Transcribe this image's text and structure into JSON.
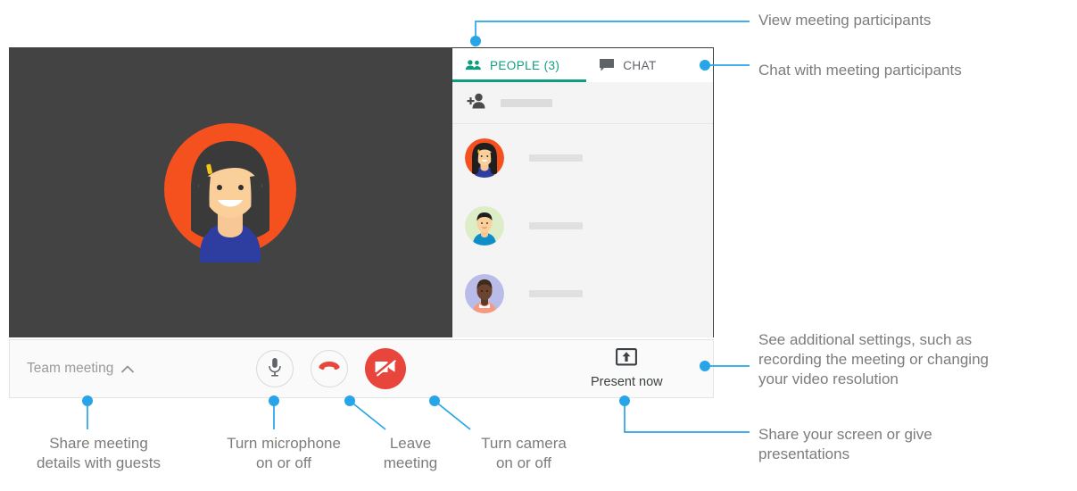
{
  "app": {
    "video_stage": {
      "avatar_name": "woman-avatar-orange-circle",
      "background_color": "#434343"
    },
    "side_panel": {
      "tabs": [
        {
          "id": "people",
          "label": "PEOPLE (3)",
          "icon": "people-icon",
          "active": true,
          "accent_color": "#0f9d7f"
        },
        {
          "id": "chat",
          "label": "CHAT",
          "icon": "chat-bubble-icon",
          "active": false
        }
      ],
      "add_person_row": {
        "icon": "add-person-icon",
        "placeholder_bar": true
      },
      "participants": [
        {
          "avatar": "woman-long-black-hair-orange-bg",
          "name_placeholder": true
        },
        {
          "avatar": "man-blue-shirt-green-bg",
          "name_placeholder": true
        },
        {
          "avatar": "person-dark-skin-purple-bg",
          "name_placeholder": true
        }
      ]
    },
    "toolbar": {
      "meeting_name": "Team meeting",
      "meeting_name_chevron": "chevron-up-icon",
      "microphone_button": {
        "icon": "microphone-icon",
        "state": "on"
      },
      "leave_button": {
        "icon": "hang-up-phone-icon",
        "color": "#e8453c"
      },
      "camera_button": {
        "icon": "camera-off-icon",
        "state": "off",
        "background": "#e8453c"
      },
      "present_now": {
        "label": "Present now",
        "icon": "present-screen-icon"
      },
      "more_options": {
        "icon": "kebab-menu-icon"
      }
    }
  },
  "annotations": {
    "view_participants": "View meeting participants",
    "chat_with_participants": "Chat with meeting participants",
    "additional_settings": "See additional settings, such as\nrecording the meeting or changing\nyour video resolution",
    "share_screen": "Share your screen or give\npresentations",
    "share_meeting": "Share meeting\ndetails with guests",
    "turn_microphone": "Turn microphone\non or off",
    "leave_meeting": "Leave\nmeeting",
    "turn_camera": "Turn camera\non or off"
  },
  "colors": {
    "callout": "#27a5e8",
    "accent_green": "#0f9d7f",
    "red": "#e8453c",
    "annotation_text": "#7c7c7c"
  }
}
